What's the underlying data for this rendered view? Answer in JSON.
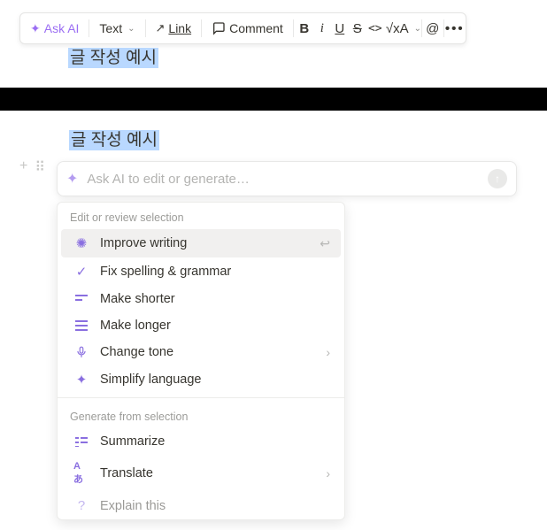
{
  "toolbar": {
    "ask_ai": "Ask AI",
    "text": "Text",
    "link": "Link",
    "comment": "Comment",
    "bold": "B",
    "italic": "i",
    "underline": "U",
    "strike": "S",
    "code": "<>",
    "equation": "√x",
    "color": "A",
    "mention": "@",
    "more": "•••"
  },
  "selection": {
    "top": "글 작성 예시",
    "bottom": "글 작성 예시"
  },
  "ai_bar": {
    "placeholder": "Ask AI to edit or generate…"
  },
  "menu": {
    "section1": "Edit or review selection",
    "improve": "Improve writing",
    "fix": "Fix spelling & grammar",
    "shorter": "Make shorter",
    "longer": "Make longer",
    "tone": "Change tone",
    "simplify": "Simplify language",
    "section2": "Generate from selection",
    "summarize": "Summarize",
    "translate": "Translate",
    "explain": "Explain this"
  }
}
